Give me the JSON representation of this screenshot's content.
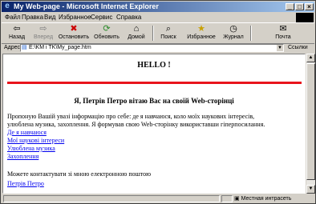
{
  "window": {
    "title": "My Web-page - Microsoft Internet Explorer"
  },
  "menu": [
    "Файл",
    "Правка",
    "Вид",
    "Избранное",
    "Сервис",
    "Справка"
  ],
  "toolbar": {
    "back": "Назад",
    "forward": "Вперед",
    "stop": "Остановить",
    "refresh": "Обновить",
    "home": "Домой",
    "search": "Поиск",
    "favorites": "Избранное",
    "history": "Журнал",
    "mail": "Почта"
  },
  "address": {
    "label": "Адрес",
    "url": "E:\\KM i TK\\My_page.htm",
    "links_label": "Ссылки"
  },
  "page": {
    "heading": "HELLO !",
    "greeting": "Я, Петрів Петро вітаю Вас на своїй Web-сторінці",
    "intro_line1": "Пропоную Вашій увазі інформацію про себе: де я навчаюся, коло моїх наукових інтересів,",
    "intro_line2": "улюблена музика, захоплення. Я формував свою Web-сторінку використавши гіперпосилання.",
    "links": [
      "Де я навчаюся",
      "Мої наукові інтереси",
      "Улюблена музика",
      "Захоплення"
    ],
    "contact_text": "Можете контактувати зі мною електронною поштою",
    "contact_link": "Петрів Петро"
  },
  "status": {
    "zone": "Местная интрасеть"
  }
}
